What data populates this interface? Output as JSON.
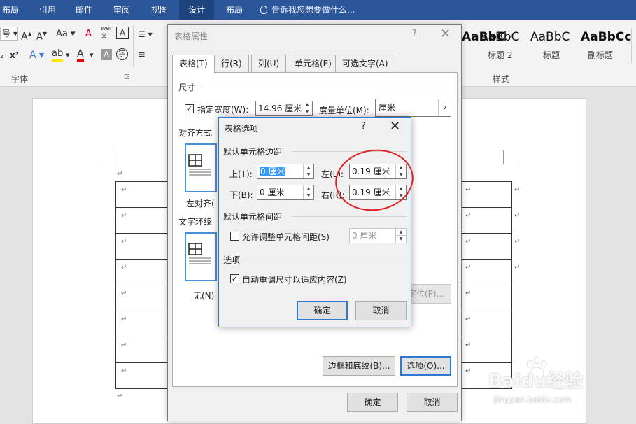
{
  "ribbon": {
    "tabs": [
      "布局",
      "引用",
      "邮件",
      "审阅",
      "视图",
      "设计",
      "布局"
    ],
    "active_tab_index": 5,
    "tell_me": "告诉我您想要做什么...",
    "font_group_label": "字体",
    "styles_group_label": "样式",
    "font_size_value": "号",
    "styles": [
      {
        "sample": "AaBbC",
        "name": "标题 2"
      },
      {
        "sample": "AaBbC",
        "name": "标题"
      },
      {
        "sample": "AaBbCc",
        "name": "副标题"
      }
    ],
    "partial_style_sample": "AaBbC",
    "partial_style_name": "标题 2"
  },
  "table_properties": {
    "title": "表格属性",
    "help": "?",
    "close": "✕",
    "tabs": [
      "表格(T)",
      "行(R)",
      "列(U)",
      "单元格(E)",
      "可选文字(A)"
    ],
    "size_section": "尺寸",
    "preferred_width_label": "指定宽度(W):",
    "preferred_width_checked": true,
    "preferred_width_value": "14.96 厘米",
    "measure_label": "度量单位(M):",
    "measure_value": "厘米",
    "alignment_section": "对齐方式",
    "align_left_label": "左对齐(",
    "wrap_section": "文字环绕",
    "wrap_none_label": "无(N)",
    "positioning_button": "定位(P)...",
    "borders_button": "边框和底纹(B)...",
    "options_button": "选项(O)...",
    "ok_button": "确定",
    "cancel_button": "取消"
  },
  "table_options": {
    "title": "表格选项",
    "help": "?",
    "close": "✕",
    "margins_section": "默认单元格边距",
    "top_label": "上(T):",
    "top_value": "0 厘米",
    "bottom_label": "下(B):",
    "bottom_value": "0 厘米",
    "left_label": "左(L):",
    "left_value": "0.19 厘米",
    "right_label": "右(R):",
    "right_value": "0.19 厘米",
    "spacing_section": "默认单元格间距",
    "allow_spacing_label": "允许调整单元格间距(S)",
    "allow_spacing_checked": false,
    "spacing_value": "0 厘米",
    "options_section": "选项",
    "autoresize_label": "自动重调尺寸以适应内容(Z)",
    "autoresize_checked": true,
    "ok_button": "确定",
    "cancel_button": "取消"
  },
  "document": {
    "paragraph_mark": "↵"
  },
  "watermark": {
    "brand": "Baidu经验",
    "url": "jingyan.baidu.com"
  },
  "colors": {
    "ribbon_blue": "#2b579a",
    "focus_blue": "#2b79d0",
    "annotation_red": "#e02020",
    "selection_blue": "#3399ff"
  }
}
